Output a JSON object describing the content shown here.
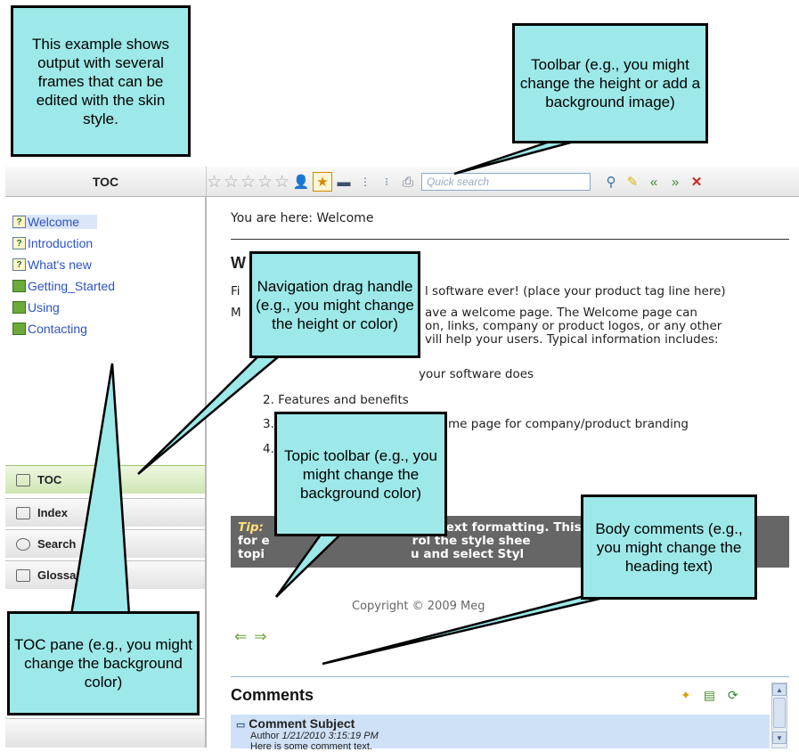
{
  "toolbar": {
    "toc_label": "TOC",
    "search_placeholder": "Quick search",
    "icons": [
      "star-rating",
      "user-icon",
      "highlight-icon",
      "monitor-icon",
      "expand-icon",
      "collapse-icon",
      "print-icon",
      "search-go-icon",
      "clear-highlight-icon",
      "back-icon",
      "forward-icon",
      "close-icon"
    ]
  },
  "toc": {
    "items": [
      {
        "label": "Welcome",
        "icon": "topic"
      },
      {
        "label": "Introduction",
        "icon": "topic"
      },
      {
        "label": "What's new",
        "icon": "topic"
      },
      {
        "label": "Getting_Started",
        "icon": "book"
      },
      {
        "label": "Using",
        "icon": "book"
      },
      {
        "label": "Contacting",
        "icon": "book"
      }
    ]
  },
  "accordion": {
    "toc": "TOC",
    "index": "Index",
    "search": "Search",
    "glossary": "Glossary"
  },
  "content": {
    "breadcrumb": "You are here: Welcome",
    "heading": "W",
    "line1a": "Fi",
    "line1b": "l software ever! (place your product tag line here)",
    "line2a": "M",
    "line2b": "ave a welcome page. The Welcome page can",
    "line3b": "on, links, company or product logos, or any other",
    "line4b": "vill help your users. Typical information includes:",
    "list1": "your software does",
    "list2": "2.  Features and benefits",
    "list3a": "3.",
    "list3b": "me page for company/product branding",
    "list4a": "4.",
    "tip_label": "Tip:",
    "tip1": "ts to control text formatting. This allows",
    "tip2a": "for e",
    "tip2b": "rol the style shee",
    "tip3a": "topi",
    "tip3b": "u and select Styl",
    "copyright": "Copyright © 2009 Meg"
  },
  "comments": {
    "heading": "Comments",
    "subject": "Comment Subject",
    "author": "Author",
    "timestamp": "1/21/2010 3:15:19 PM",
    "text": "Here is some comment text."
  },
  "callouts": {
    "frames": "This example shows output with several frames that can be edited with the skin style.",
    "toolbar": "Toolbar (e.g., you might change the height or add a background image)",
    "nav_handle": "Navigation drag handle (e.g., you might change the height or color)",
    "topic_toolbar": "Topic toolbar (e.g., you might change the background color)",
    "body_comments": "Body comments (e.g., you might change the heading text)",
    "toc_pane": "TOC pane (e.g., you might change the background color)"
  }
}
